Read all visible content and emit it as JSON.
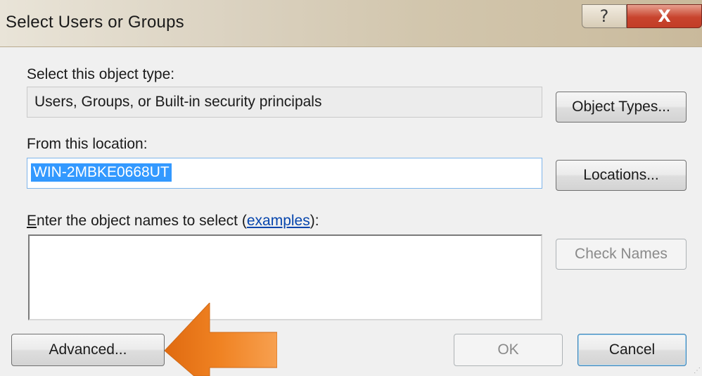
{
  "window": {
    "title": "Select Users or Groups",
    "help_glyph": "?",
    "close_glyph": "X"
  },
  "object_type": {
    "label": "Select this object type:",
    "value": "Users, Groups, or Built-in security principals",
    "button": "Object Types..."
  },
  "location": {
    "label": "From this location:",
    "value": "WIN-2MBKE0668UT",
    "button": "Locations..."
  },
  "names": {
    "label_prefix_mnemonic": "E",
    "label_prefix_rest": "nter the object names to select (",
    "examples_link": "examples",
    "label_suffix": "):",
    "value": "",
    "check_button": "Check Names"
  },
  "footer": {
    "advanced_button": "Advanced...",
    "ok_button": "OK",
    "cancel_button": "Cancel"
  },
  "annotation": {
    "arrow_color": "#f08323",
    "arrow_icon": "orange-pointer-arrow-icon"
  },
  "colors": {
    "selection": "#3399ff",
    "close_button": "#c8442e",
    "link": "#0645ad"
  }
}
